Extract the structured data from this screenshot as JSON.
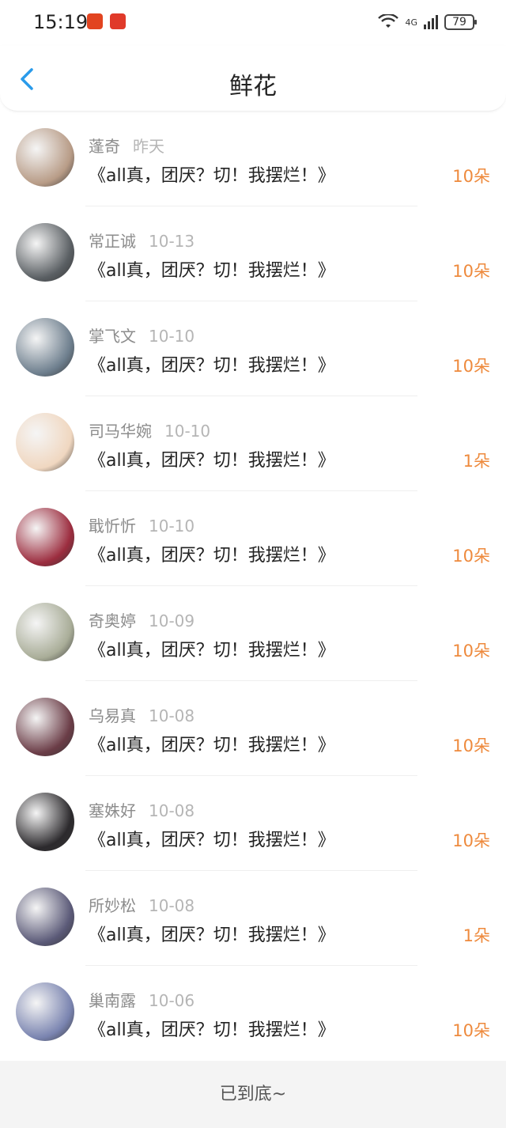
{
  "status": {
    "time": "15:19",
    "battery": "79",
    "network": "4G"
  },
  "header": {
    "title": "鲜花"
  },
  "items": [
    {
      "name": "蓬奇",
      "date": "昨天",
      "text": "《all真，团厌？切！我摆烂！》",
      "count": "10朵",
      "avatar_color": "#b89c87"
    },
    {
      "name": "常正诚",
      "date": "10-13",
      "text": "《all真，团厌？切！我摆烂！》",
      "count": "10朵",
      "avatar_color": "#5a5f63"
    },
    {
      "name": "掌飞文",
      "date": "10-10",
      "text": "《all真，团厌？切！我摆烂！》",
      "count": "10朵",
      "avatar_color": "#6e7f8e"
    },
    {
      "name": "司马华婉",
      "date": "10-10",
      "text": "《all真，团厌？切！我摆烂！》",
      "count": "1朵",
      "avatar_color": "#f0d7c0"
    },
    {
      "name": "戢忻忻",
      "date": "10-10",
      "text": "《all真，团厌？切！我摆烂！》",
      "count": "10朵",
      "avatar_color": "#9c2d3f"
    },
    {
      "name": "奇奥婷",
      "date": "10-09",
      "text": "《all真，团厌？切！我摆烂！》",
      "count": "10朵",
      "avatar_color": "#a9ad98"
    },
    {
      "name": "乌易真",
      "date": "10-08",
      "text": "《all真，团厌？切！我摆烂！》",
      "count": "10朵",
      "avatar_color": "#6b3d47"
    },
    {
      "name": "塞姝好",
      "date": "10-08",
      "text": "《all真，团厌？切！我摆烂！》",
      "count": "10朵",
      "avatar_color": "#2c2a2d"
    },
    {
      "name": "所妙松",
      "date": "10-08",
      "text": "《all真，团厌？切！我摆烂！》",
      "count": "1朵",
      "avatar_color": "#5b5a78"
    },
    {
      "name": "巢南露",
      "date": "10-06",
      "text": "《all真，团厌？切！我摆烂！》",
      "count": "10朵",
      "avatar_color": "#7a84b0"
    }
  ],
  "footer": {
    "text": "已到底~"
  },
  "colors": {
    "accent": "#2a9bea",
    "count": "#ee8a3d"
  }
}
